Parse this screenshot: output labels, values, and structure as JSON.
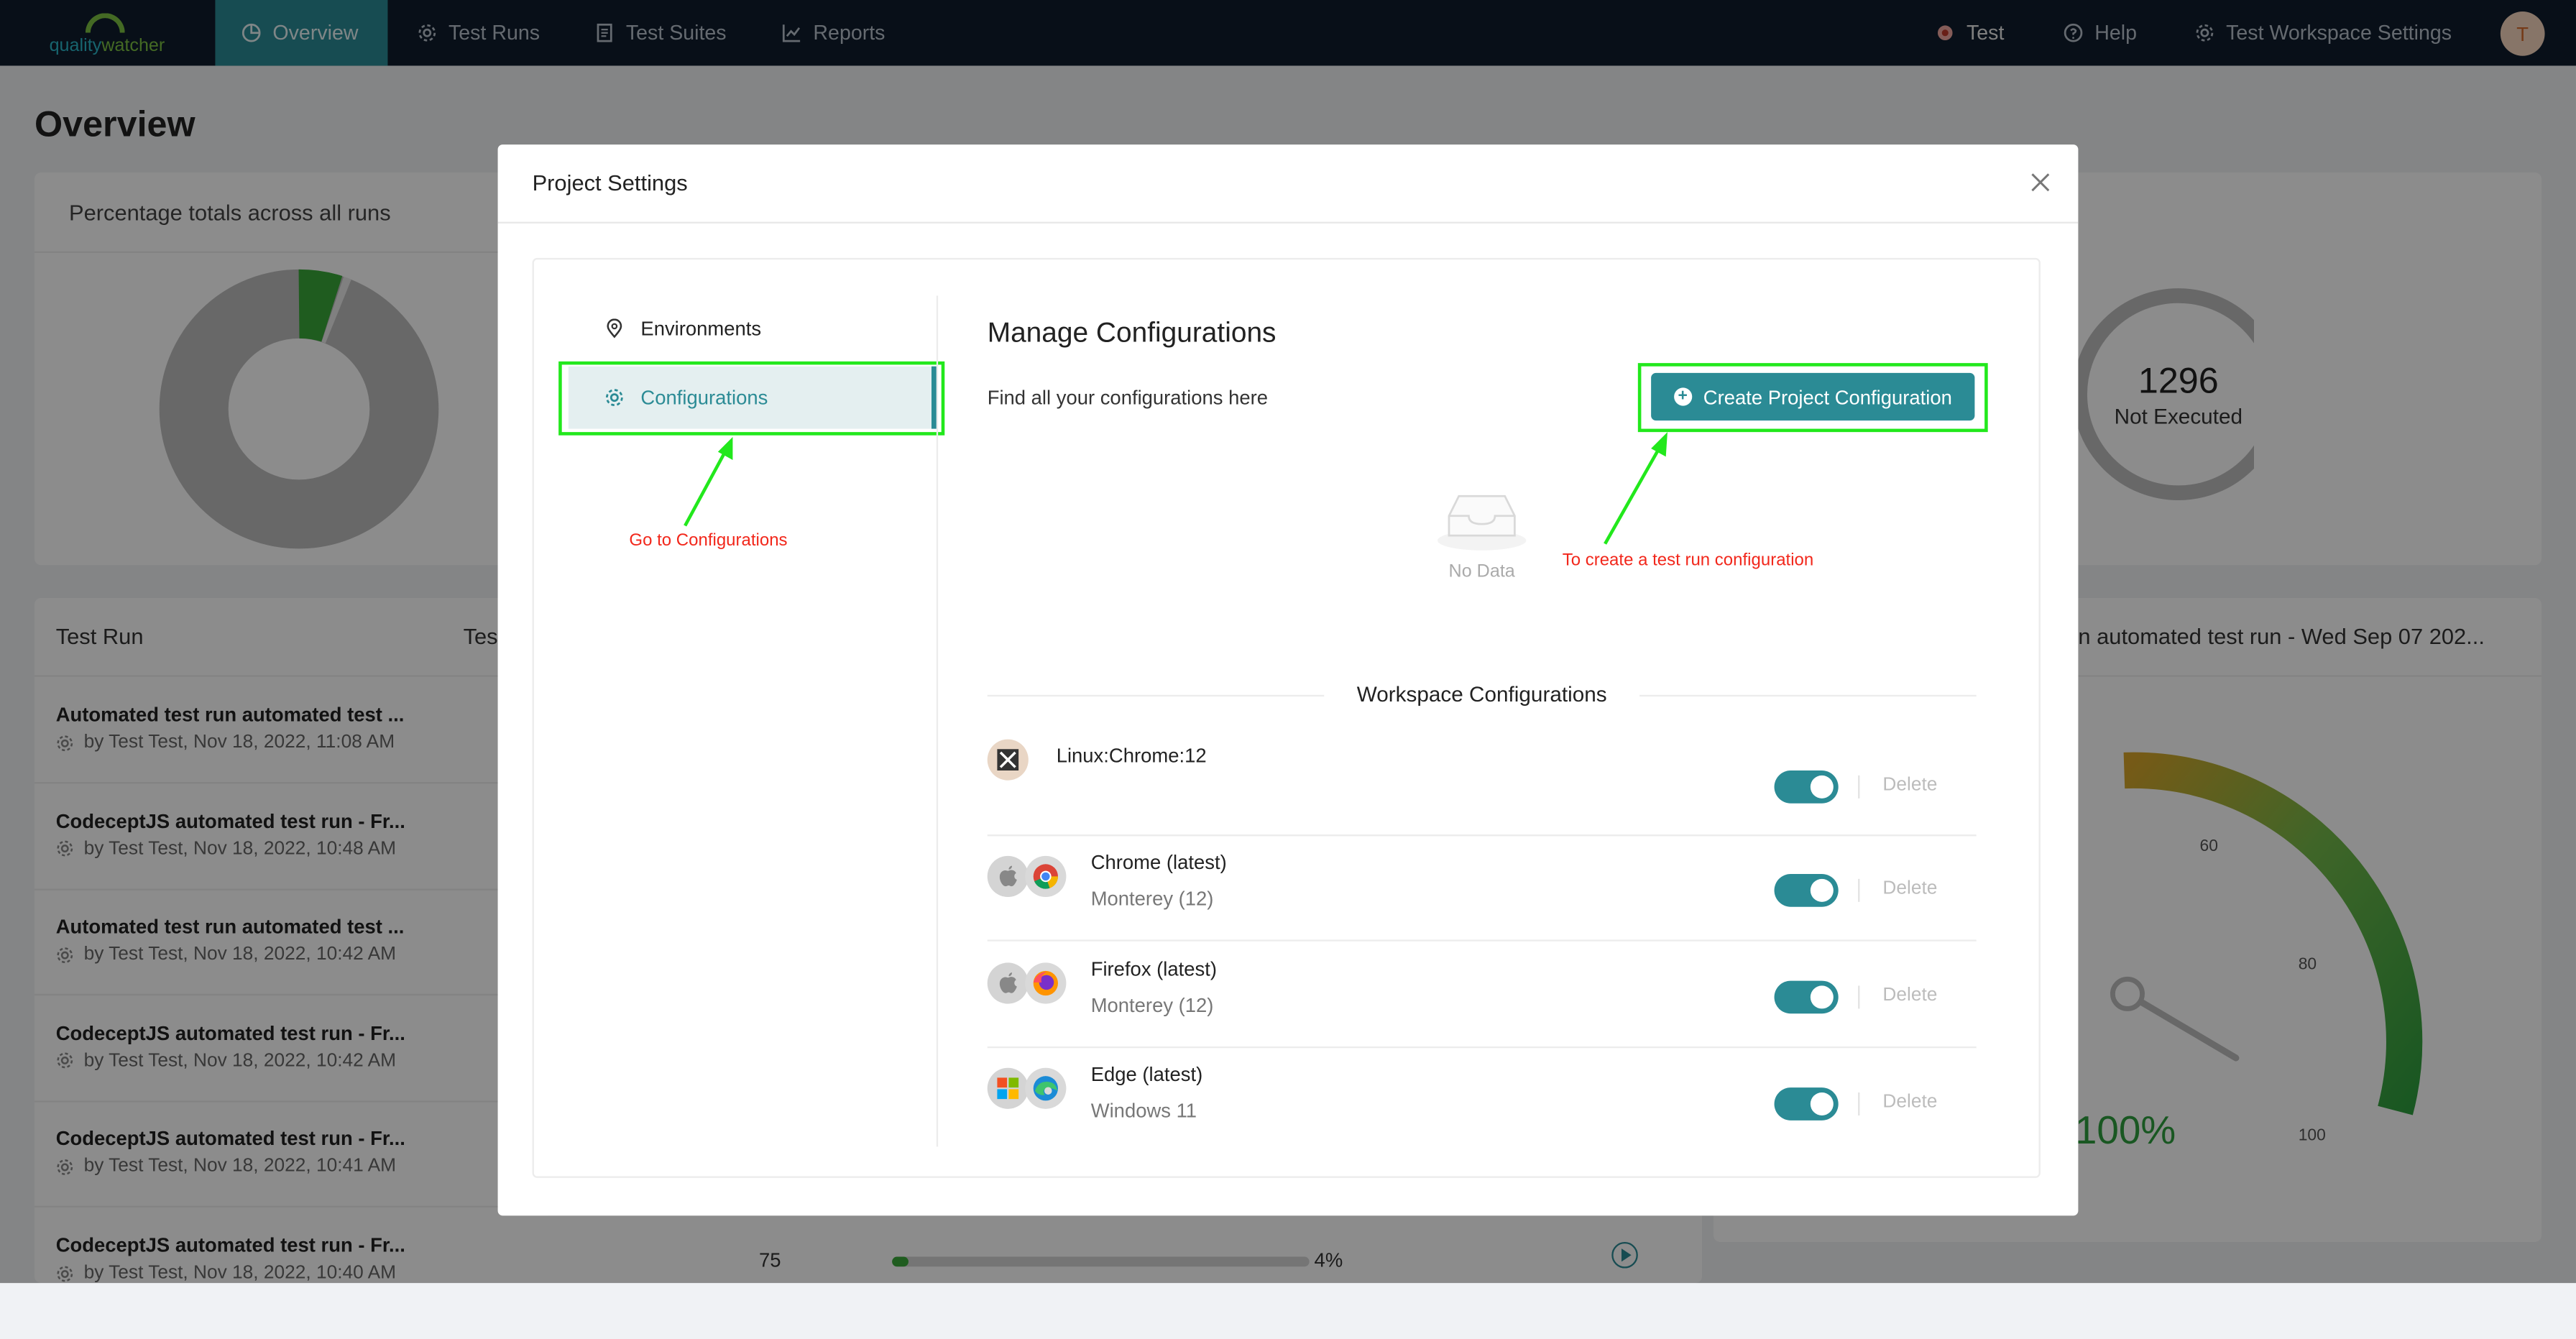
{
  "topbar": {
    "logo": {
      "quality": "quality",
      "watcher": "watcher"
    },
    "nav": [
      {
        "label": "Overview"
      },
      {
        "label": "Test Runs"
      },
      {
        "label": "Test Suites"
      },
      {
        "label": "Reports"
      }
    ],
    "right": [
      {
        "label": "Test"
      },
      {
        "label": "Help"
      },
      {
        "label": "Test Workspace Settings"
      }
    ],
    "avatar": "T"
  },
  "page": {
    "title": "Overview",
    "percentage_card_title": "Percentage totals across all runs",
    "not_executed": {
      "count": "1296",
      "label": "Not Executed"
    },
    "list_header": {
      "test_run": "Test Run",
      "col2": "Tes"
    },
    "runs": [
      {
        "title": "Automated test run automated test ...",
        "meta": "by Test Test, Nov 18, 2022, 11:08 AM"
      },
      {
        "title": "CodeceptJS automated test run - Fr...",
        "meta": "by Test Test, Nov 18, 2022, 10:48 AM"
      },
      {
        "title": "Automated test run automated test ...",
        "meta": "by Test Test, Nov 18, 2022, 10:42 AM"
      },
      {
        "title": "CodeceptJS automated test run - Fr...",
        "meta": "by Test Test, Nov 18, 2022, 10:42 AM"
      },
      {
        "title": "CodeceptJS automated test run - Fr...",
        "meta": "by Test Test, Nov 18, 2022, 10:41 AM"
      },
      {
        "title": "CodeceptJS automated test run - Fr...",
        "meta": "by Test Test, Nov 18, 2022, 10:40 AM"
      }
    ],
    "last_row": {
      "count": "75",
      "percent": "4%",
      "progress": 0.04
    },
    "gauge_card_title": "n automated test run - Wed Sep 07 202...",
    "gauge": {
      "value_label": "100%",
      "ticks": [
        "60",
        "80",
        "100"
      ]
    }
  },
  "modal": {
    "title": "Project Settings",
    "sidebar": [
      {
        "label": "Environments",
        "icon": "location-pin-icon"
      },
      {
        "label": "Configurations",
        "icon": "gear-icon"
      }
    ],
    "heading": "Manage Configurations",
    "subtitle": "Find all your configurations here",
    "create_button": "Create Project Configuration",
    "empty_text": "No Data",
    "workspace_title": "Workspace Configurations",
    "configs": [
      {
        "name": "Linux:Chrome:12",
        "sub": "",
        "enabled": true,
        "delete": "Delete"
      },
      {
        "name": "Chrome (latest)",
        "sub": "Monterey (12)",
        "enabled": true,
        "delete": "Delete"
      },
      {
        "name": "Firefox (latest)",
        "sub": "Monterey (12)",
        "enabled": true,
        "delete": "Delete"
      },
      {
        "name": "Edge (latest)",
        "sub": "Windows 11",
        "enabled": true,
        "delete": "Delete"
      }
    ]
  },
  "annotations": {
    "go_to_configurations": "Go to Configurations",
    "create_config": "To create a test run configuration"
  },
  "colors": {
    "accent": "#2b8b95",
    "nav_bg": "#0f1d2c",
    "highlight": "#22e81c",
    "annotation": "#f2271b"
  }
}
